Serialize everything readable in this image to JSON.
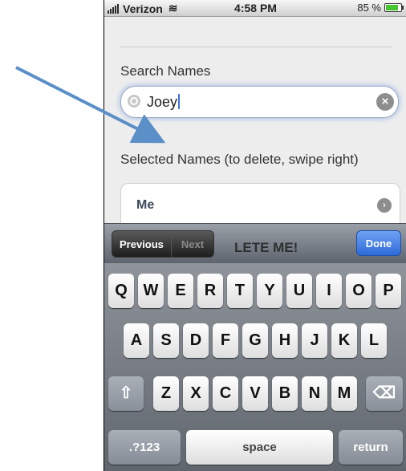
{
  "status_bar": {
    "carrier": "Verizon",
    "time": "4:58 PM",
    "battery_percent": "85 %"
  },
  "page": {
    "search_label": "Search Names",
    "search_value": "Joey",
    "selected_label": "Selected Names (to delete, swipe right)",
    "selected_items": [
      {
        "name": "Me"
      }
    ],
    "partially_hidden_button": "LETE ME!"
  },
  "toolbar": {
    "previous": "Previous",
    "next": "Next",
    "done": "Done"
  },
  "keyboard": {
    "row1": [
      "Q",
      "W",
      "E",
      "R",
      "T",
      "Y",
      "U",
      "I",
      "O",
      "P"
    ],
    "row2": [
      "A",
      "S",
      "D",
      "F",
      "G",
      "H",
      "J",
      "K",
      "L"
    ],
    "row3": [
      "Z",
      "X",
      "C",
      "V",
      "B",
      "N",
      "M"
    ],
    "mode_key": ".?123",
    "space_key": "space",
    "return_key": "return"
  },
  "colors": {
    "accent_blue": "#2d6bd8",
    "arrow": "#5b8fc7",
    "battery_green": "#46c52f"
  }
}
